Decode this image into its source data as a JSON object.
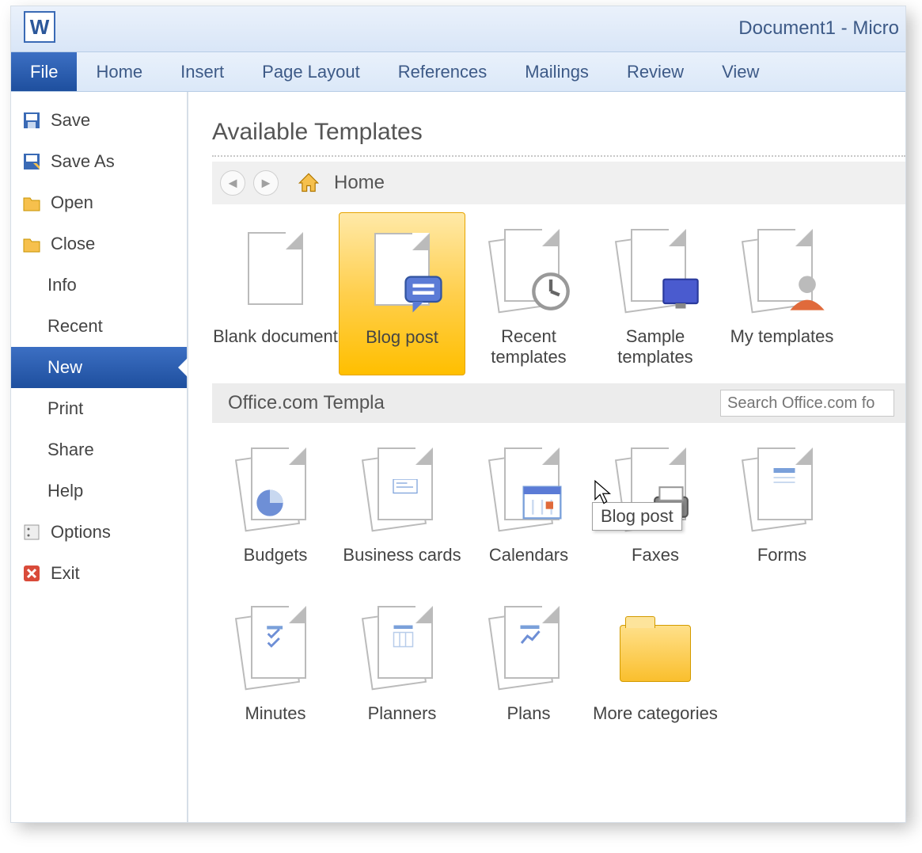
{
  "window": {
    "title": "Document1 - Micro"
  },
  "ribbon": {
    "tabs": [
      "File",
      "Home",
      "Insert",
      "Page Layout",
      "References",
      "Mailings",
      "Review",
      "View"
    ],
    "active": "File"
  },
  "sidebar": {
    "items": [
      {
        "label": "Save",
        "icon": "save"
      },
      {
        "label": "Save As",
        "icon": "save-as"
      },
      {
        "label": "Open",
        "icon": "open"
      },
      {
        "label": "Close",
        "icon": "close"
      },
      {
        "label": "Info",
        "icon": null
      },
      {
        "label": "Recent",
        "icon": null
      },
      {
        "label": "New",
        "icon": null,
        "selected": true
      },
      {
        "label": "Print",
        "icon": null
      },
      {
        "label": "Share",
        "icon": null
      },
      {
        "label": "Help",
        "icon": null
      },
      {
        "label": "Options",
        "icon": "options"
      },
      {
        "label": "Exit",
        "icon": "exit"
      }
    ]
  },
  "content": {
    "heading": "Available Templates",
    "breadcrumb": "Home",
    "templates_row1": [
      {
        "label": "Blank document",
        "icon": "blank"
      },
      {
        "label": "Blog post",
        "icon": "blog",
        "selected": true
      },
      {
        "label": "Recent templates",
        "icon": "recent"
      },
      {
        "label": "Sample templates",
        "icon": "sample"
      },
      {
        "label": "My templates",
        "icon": "my"
      }
    ],
    "office_section": "Office.com Templa",
    "search_placeholder": "Search Office.com fo",
    "templates_row2": [
      {
        "label": "Budgets"
      },
      {
        "label": "Business cards"
      },
      {
        "label": "Calendars"
      },
      {
        "label": "Faxes"
      },
      {
        "label": "Forms"
      }
    ],
    "templates_row3": [
      {
        "label": "Minutes"
      },
      {
        "label": "Planners"
      },
      {
        "label": "Plans"
      },
      {
        "label": "More categories",
        "icon": "folder"
      }
    ],
    "tooltip": "Blog post"
  }
}
